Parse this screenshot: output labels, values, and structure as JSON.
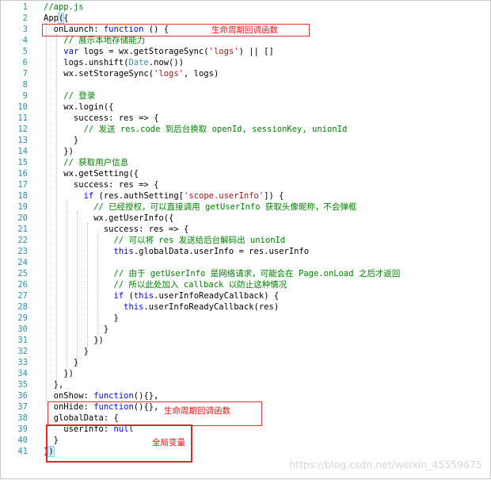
{
  "editor": {
    "lines": [
      {
        "num": "1",
        "text": "//app.js"
      },
      {
        "num": "2",
        "text": "App({"
      },
      {
        "num": "3",
        "text": "  onLaunch: function () {"
      },
      {
        "num": "4",
        "text": "    // 展示本地存储能力"
      },
      {
        "num": "5",
        "text": "    var logs = wx.getStorageSync('logs') || []"
      },
      {
        "num": "6",
        "text": "    logs.unshift(Date.now())"
      },
      {
        "num": "7",
        "text": "    wx.setStorageSync('logs', logs)"
      },
      {
        "num": "8",
        "text": ""
      },
      {
        "num": "9",
        "text": "    // 登录"
      },
      {
        "num": "10",
        "text": "    wx.login({"
      },
      {
        "num": "11",
        "text": "      success: res => {"
      },
      {
        "num": "12",
        "text": "        // 发送 res.code 到后台换取 openId, sessionKey, unionId"
      },
      {
        "num": "13",
        "text": "      }"
      },
      {
        "num": "14",
        "text": "    })"
      },
      {
        "num": "15",
        "text": "    // 获取用户信息"
      },
      {
        "num": "16",
        "text": "    wx.getSetting({"
      },
      {
        "num": "17",
        "text": "      success: res => {"
      },
      {
        "num": "18",
        "text": "        if (res.authSetting['scope.userInfo']) {"
      },
      {
        "num": "19",
        "text": "          // 已经授权，可以直接调用 getUserInfo 获取头像昵称，不会弹框"
      },
      {
        "num": "20",
        "text": "          wx.getUserInfo({"
      },
      {
        "num": "21",
        "text": "            success: res => {"
      },
      {
        "num": "22",
        "text": "              // 可以将 res 发送给后台解码出 unionId"
      },
      {
        "num": "23",
        "text": "              this.globalData.userInfo = res.userInfo"
      },
      {
        "num": "24",
        "text": ""
      },
      {
        "num": "25",
        "text": "              // 由于 getUserInfo 是网络请求，可能会在 Page.onLoad 之后才返回"
      },
      {
        "num": "26",
        "text": "              // 所以此处加入 callback 以防止这种情况"
      },
      {
        "num": "27",
        "text": "              if (this.userInfoReadyCallback) {"
      },
      {
        "num": "28",
        "text": "                this.userInfoReadyCallback(res)"
      },
      {
        "num": "29",
        "text": "              }"
      },
      {
        "num": "30",
        "text": "            }"
      },
      {
        "num": "31",
        "text": "          })"
      },
      {
        "num": "32",
        "text": "        }"
      },
      {
        "num": "33",
        "text": "      }"
      },
      {
        "num": "34",
        "text": "    })"
      },
      {
        "num": "35",
        "text": "  },"
      },
      {
        "num": "36",
        "text": "  onShow: function(){},"
      },
      {
        "num": "37",
        "text": "  onHide: function(){},"
      },
      {
        "num": "38",
        "text": "  globalData: {"
      },
      {
        "num": "39",
        "text": "    userInfo: null"
      },
      {
        "num": "40",
        "text": "  }"
      },
      {
        "num": "41",
        "text": "})"
      }
    ]
  },
  "annotations": {
    "lifecycle_top": "生命周期回调函数",
    "lifecycle_bottom": "生命周期回调函数",
    "global_var": "全局变量"
  },
  "watermark": "https://blog.csdn.net/weixin_45559675",
  "colors": {
    "comment": "#008000",
    "keyword": "#0000ff",
    "string": "#a31515",
    "type": "#2b91af",
    "line_number": "#2b91af",
    "annotation": "#ee1111"
  }
}
